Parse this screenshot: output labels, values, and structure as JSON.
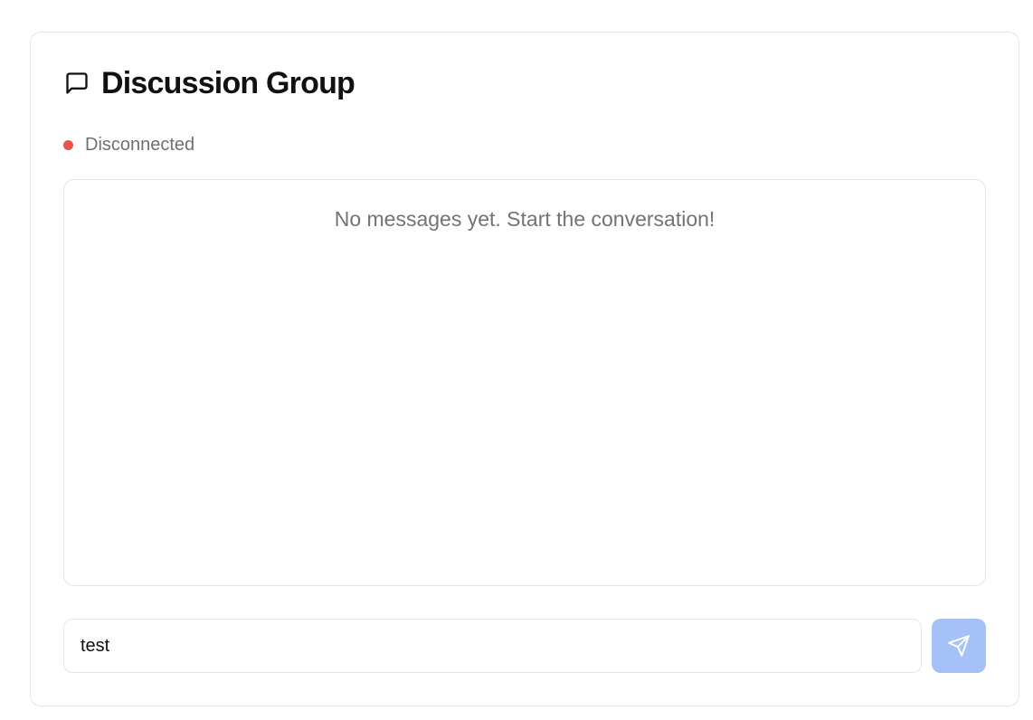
{
  "header": {
    "title": "Discussion Group",
    "icon": "message-square-icon"
  },
  "status": {
    "label": "Disconnected",
    "color": "#e5534b"
  },
  "messages": {
    "empty_text": "No messages yet. Start the conversation!",
    "items": []
  },
  "composer": {
    "value": "test",
    "send_icon": "send-icon",
    "send_button_color": "#a6c1f7"
  }
}
